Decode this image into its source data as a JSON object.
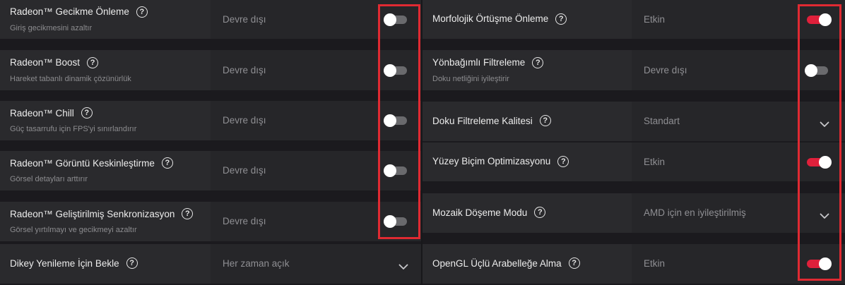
{
  "accent": "#e0203b",
  "highlight_color": "#e02a32",
  "left_settings": [
    {
      "title": "Radeon™ Gecikme Önleme",
      "subtitle": "Giriş gecikmesini azaltır",
      "value": "Devre dışı",
      "control": "toggle",
      "state": "off"
    },
    {
      "title": "Radeon™ Boost",
      "subtitle": "Hareket tabanlı dinamik çözünürlük",
      "value": "Devre dışı",
      "control": "toggle",
      "state": "off"
    },
    {
      "title": "Radeon™ Chill",
      "subtitle": "Güç tasarrufu için FPS'yi sınırlandırır",
      "value": "Devre dışı",
      "control": "toggle",
      "state": "off"
    },
    {
      "title": "Radeon™ Görüntü Keskinleştirme",
      "subtitle": "Görsel detayları arttırır",
      "value": "Devre dışı",
      "control": "toggle",
      "state": "off"
    },
    {
      "title": "Radeon™ Geliştirilmiş Senkronizasyon",
      "subtitle": "Görsel yırtılmayı ve gecikmeyi azaltır",
      "value": "Devre dışı",
      "control": "toggle",
      "state": "off"
    },
    {
      "title": "Dikey Yenileme İçin Bekle",
      "subtitle": "",
      "value": "Her zaman açık",
      "control": "dropdown",
      "state": ""
    }
  ],
  "right_settings": [
    {
      "title": "Morfolojik Örtüşme Önleme",
      "subtitle": "",
      "value": "Etkin",
      "control": "toggle",
      "state": "on"
    },
    {
      "title": "Yönbağımlı Filtreleme",
      "subtitle": "Doku netliğini iyileştirir",
      "value": "Devre dışı",
      "control": "toggle",
      "state": "off"
    },
    {
      "title": "Doku Filtreleme Kalitesi",
      "subtitle": "",
      "value": "Standart",
      "control": "dropdown",
      "state": ""
    },
    {
      "title": "Yüzey Biçim Optimizasyonu",
      "subtitle": "",
      "value": "Etkin",
      "control": "toggle",
      "state": "on"
    },
    {
      "title": "Mozaik Döşeme Modu",
      "subtitle": "",
      "value": "AMD için en iyileştirilmiş",
      "control": "dropdown",
      "state": ""
    },
    {
      "title": "OpenGL Üçlü Arabelleğe Alma",
      "subtitle": "",
      "value": "Etkin",
      "control": "toggle",
      "state": "on"
    }
  ]
}
